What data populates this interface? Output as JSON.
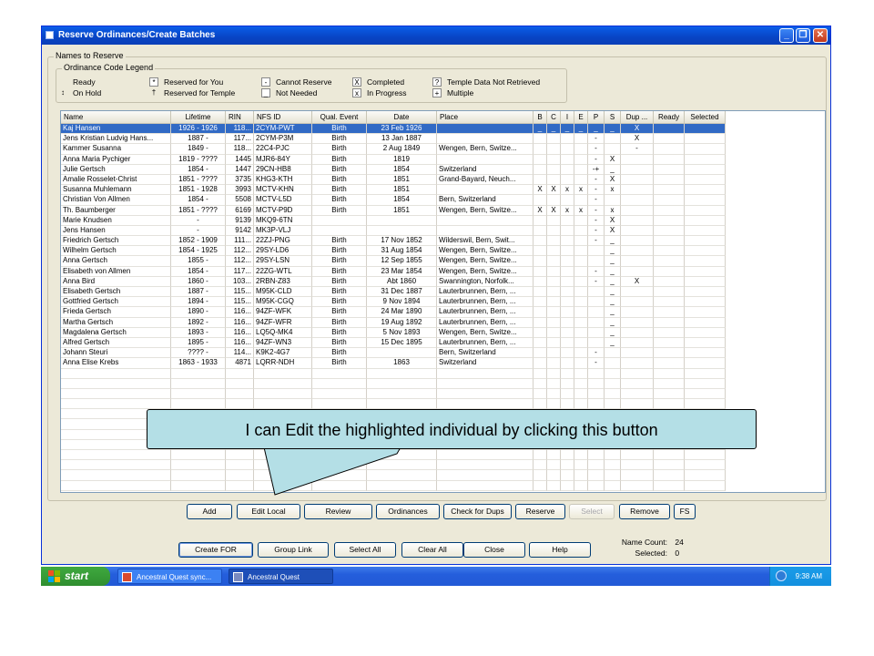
{
  "window": {
    "title": "Reserve Ordinances/Create Batches"
  },
  "names_group_label": "Names to Reserve",
  "legend": {
    "title": "Ordinance Code Legend",
    "items": [
      {
        "symbol": "",
        "label": "Ready"
      },
      {
        "symbol": "↕",
        "label": "On Hold"
      },
      {
        "symbol": "*",
        "label": "Reserved for You"
      },
      {
        "symbol": "†",
        "label": "Reserved for Temple"
      },
      {
        "symbol": "-",
        "label": "Cannot Reserve"
      },
      {
        "symbol": "_",
        "label": "Not Needed"
      },
      {
        "symbol": "X",
        "label": "Completed"
      },
      {
        "symbol": "x",
        "label": "In Progress"
      },
      {
        "symbol": "?",
        "label": "Temple Data Not Retrieved"
      },
      {
        "symbol": "+",
        "label": "Multiple"
      }
    ]
  },
  "grid": {
    "headers": [
      "Name",
      "Lifetime",
      "RIN",
      "NFS ID",
      "Qual. Event",
      "Date",
      "Place",
      "B",
      "C",
      "I",
      "E",
      "P",
      "S",
      "Dup ...",
      "Ready",
      "Selected"
    ],
    "rows": [
      [
        "Kaj Hansen",
        "1926 - 1926",
        "118...",
        "2CYM-PWT",
        "Birth",
        "23 Feb 1926",
        "",
        "_",
        "_",
        "_",
        "_",
        "_",
        "_",
        "X",
        "",
        ""
      ],
      [
        "Jens Kristian Ludvig Hans...",
        "1887 -",
        "117...",
        "2CYM-P3M",
        "Birth",
        "13 Jan 1887",
        "",
        "",
        "",
        "",
        "",
        "-",
        "",
        "X",
        "",
        ""
      ],
      [
        "Kammer Susanna",
        "1849 -",
        "118...",
        "22C4-PJC",
        "Birth",
        "2 Aug 1849",
        "Wengen, Bern, Switze...",
        "",
        "",
        "",
        "",
        "-",
        "",
        "-",
        "",
        ""
      ],
      [
        "Anna Maria Pychiger",
        "1819 - ????",
        "1445",
        "MJR6-84Y",
        "Birth",
        "1819",
        "",
        "",
        "",
        "",
        "",
        "-",
        "X",
        "",
        "",
        ""
      ],
      [
        "Julie Gertsch",
        "1854 -",
        "1447",
        "29CN-HB8",
        "Birth",
        "1854",
        "Switzerland",
        "",
        "",
        "",
        "",
        "-+",
        "_",
        "",
        "",
        ""
      ],
      [
        "Amalie Rosselet-Christ",
        "1851 - ????",
        "3735",
        "KHG3-KTH",
        "Birth",
        "1851",
        "Grand-Bayard, Neuch...",
        "",
        "",
        "",
        "",
        "-",
        "X",
        "",
        "",
        ""
      ],
      [
        "Susanna Muhlemann",
        "1851 - 1928",
        "3993",
        "MCTV-KHN",
        "Birth",
        "1851",
        "",
        "X",
        "X",
        "x",
        "x",
        "-",
        "x",
        "",
        "",
        ""
      ],
      [
        "Christian Von Allmen",
        "1854 -",
        "5508",
        "MCTV-L5D",
        "Birth",
        "1854",
        "Bern, Switzerland",
        "",
        "",
        "",
        "",
        "-",
        "",
        "",
        "",
        ""
      ],
      [
        "Th. Baumberger",
        "1851 - ????",
        "6169",
        "MCTV-P9D",
        "Birth",
        "1851",
        "Wengen, Bern, Switze...",
        "X",
        "X",
        "x",
        "x",
        "-",
        "x",
        "",
        "",
        ""
      ],
      [
        "Marie Knudsen",
        "-",
        "9139",
        "MKQ9-6TN",
        "",
        "",
        "",
        "",
        "",
        "",
        "",
        "-",
        "X",
        "",
        "",
        ""
      ],
      [
        "Jens Hansen",
        "-",
        "9142",
        "MK3P-VLJ",
        "",
        "",
        "",
        "",
        "",
        "",
        "",
        "-",
        "X",
        "",
        "",
        ""
      ],
      [
        "Friedrich Gertsch",
        "1852 - 1909",
        "111...",
        "22ZJ-PNG",
        "Birth",
        "17 Nov 1852",
        "Wilderswil, Bern, Swit...",
        "",
        "",
        "",
        "",
        "-",
        "_",
        "",
        "",
        ""
      ],
      [
        "Wilhelm Gertsch",
        "1854 - 1925",
        "112...",
        "29SY-LD6",
        "Birth",
        "31 Aug 1854",
        "Wengen, Bern, Switze...",
        "",
        "",
        "",
        "",
        "",
        "_",
        "",
        "",
        ""
      ],
      [
        "Anna Gertsch",
        "1855 -",
        "112...",
        "29SY-LSN",
        "Birth",
        "12 Sep 1855",
        "Wengen, Bern, Switze...",
        "",
        "",
        "",
        "",
        "",
        "_",
        "",
        "",
        ""
      ],
      [
        "Elisabeth von Allmen",
        "1854 -",
        "117...",
        "22ZG-WTL",
        "Birth",
        "23 Mar 1854",
        "Wengen, Bern, Switze...",
        "",
        "",
        "",
        "",
        "-",
        "_",
        "",
        "",
        ""
      ],
      [
        "Anna Bird",
        "1860 -",
        "103...",
        "2RBN-Z83",
        "Birth",
        "Abt 1860",
        "Swannington, Norfolk...",
        "",
        "",
        "",
        "",
        "-",
        "_",
        "X",
        "",
        ""
      ],
      [
        "Elisabeth Gertsch",
        "1887 -",
        "115...",
        "M95K-CLD",
        "Birth",
        "31 Dec 1887",
        "Lauterbrunnen, Bern, ...",
        "",
        "",
        "",
        "",
        "",
        "_",
        "",
        "",
        ""
      ],
      [
        "Gottfried Gertsch",
        "1894 -",
        "115...",
        "M95K-CGQ",
        "Birth",
        "9 Nov 1894",
        "Lauterbrunnen, Bern, ...",
        "",
        "",
        "",
        "",
        "",
        "_",
        "",
        "",
        ""
      ],
      [
        "Frieda Gertsch",
        "1890 -",
        "116...",
        "94ZF-WFK",
        "Birth",
        "24 Mar 1890",
        "Lauterbrunnen, Bern, ...",
        "",
        "",
        "",
        "",
        "",
        "_",
        "",
        "",
        ""
      ],
      [
        "Martha Gertsch",
        "1892 -",
        "116...",
        "94ZF-WFR",
        "Birth",
        "19 Aug 1892",
        "Lauterbrunnen, Bern, ...",
        "",
        "",
        "",
        "",
        "",
        "_",
        "",
        "",
        ""
      ],
      [
        "Magdalena Gertsch",
        "1893 -",
        "116...",
        "LQ5Q-MK4",
        "Birth",
        "5 Nov 1893",
        "Wengen, Bern, Switze...",
        "",
        "",
        "",
        "",
        "",
        "_",
        "",
        "",
        ""
      ],
      [
        "Alfred Gertsch",
        "1895 -",
        "116...",
        "94ZF-WN3",
        "Birth",
        "15 Dec 1895",
        "Lauterbrunnen, Bern, ...",
        "",
        "",
        "",
        "",
        "",
        "_",
        "",
        "",
        ""
      ],
      [
        "Johann Steuri",
        "???? -",
        "114...",
        "K9K2-4G7",
        "Birth",
        "",
        "Bern, Switzerland",
        "",
        "",
        "",
        "",
        "-",
        "",
        "",
        "",
        ""
      ],
      [
        "Anna Elise Krebs",
        "1863 - 1933",
        "4871",
        "LQRR-NDH",
        "Birth",
        "1863",
        "Switzerland",
        "",
        "",
        "",
        "",
        "-",
        "",
        "",
        "",
        ""
      ]
    ],
    "selected_row": 0
  },
  "callout": {
    "text": "I can Edit the highlighted individual by clicking this button"
  },
  "action_buttons": [
    {
      "name": "add-button",
      "label": "Add",
      "enabled": true
    },
    {
      "name": "edit-local-button",
      "label": "Edit Local",
      "enabled": true
    },
    {
      "name": "review-button",
      "label": "Review",
      "enabled": true
    },
    {
      "name": "ordinances-button",
      "label": "Ordinances",
      "enabled": true
    },
    {
      "name": "check-for-dups-button",
      "label": "Check for Dups",
      "enabled": true
    },
    {
      "name": "reserve-button",
      "label": "Reserve",
      "enabled": true
    },
    {
      "name": "select-button",
      "label": "Select",
      "enabled": false
    },
    {
      "name": "remove-button",
      "label": "Remove",
      "enabled": true
    },
    {
      "name": "fs-button",
      "label": "FS",
      "enabled": true
    }
  ],
  "bottom_buttons": [
    {
      "name": "create-for-button",
      "label": "Create FOR"
    },
    {
      "name": "group-link-button",
      "label": "Group Link"
    },
    {
      "name": "select-all-button",
      "label": "Select All"
    },
    {
      "name": "clear-all-button",
      "label": "Clear All"
    },
    {
      "name": "close-button",
      "label": "Close"
    },
    {
      "name": "help-button",
      "label": "Help"
    }
  ],
  "counts": {
    "name_count_label": "Name Count:",
    "name_count": "24",
    "selected_label": "Selected:",
    "selected": "0"
  },
  "taskbar": {
    "start": "start",
    "tasks": [
      {
        "label": "Ancestral Quest sync..."
      },
      {
        "label": "Ancestral Quest"
      }
    ],
    "clock": "9:38 AM"
  }
}
